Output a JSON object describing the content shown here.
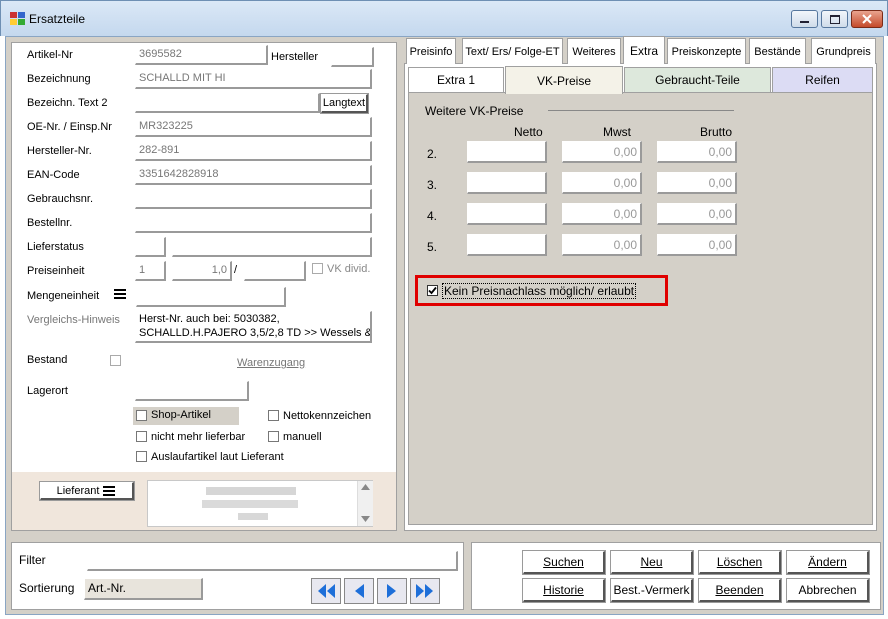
{
  "window": {
    "title": "Ersatzteile"
  },
  "form": {
    "artikel_nr": {
      "label": "Artikel-Nr",
      "value": "3695582"
    },
    "hersteller": {
      "label": "Hersteller"
    },
    "bezeichnung": {
      "label": "Bezeichnung",
      "value": "SCHALLD MIT HI"
    },
    "bezeichn_text2": {
      "label": "Bezeichn. Text 2",
      "value": ""
    },
    "langtext_button": "Langtext",
    "oe_nr": {
      "label": "OE-Nr. / Einsp.Nr",
      "value": "MR323225"
    },
    "hersteller_nr": {
      "label": "Hersteller-Nr.",
      "value": "282-891"
    },
    "ean_code": {
      "label": "EAN-Code",
      "value": "3351642828918"
    },
    "gebrauchsnr": {
      "label": "Gebrauchsnr."
    },
    "bestellnr": {
      "label": "Bestellnr."
    },
    "lieferstatus": {
      "label": "Lieferstatus"
    },
    "preiseinheit": {
      "label": "Preiseinheit",
      "value1": "1",
      "value2": "1,0",
      "slash": "/"
    },
    "vk_divid": "VK divid.",
    "mengeneinheit": {
      "label": "Mengeneinheit"
    },
    "vergleichs_hinweis": {
      "label": "Vergleichs-Hinweis",
      "line1": "Herst-Nr. auch bei: 5030382,",
      "line2": "SCHALLD.H.PAJERO 3,5/2,8 TD >> Wessels &"
    },
    "bestand": {
      "label": "Bestand"
    },
    "warenzugang": "Warenzugang",
    "lagerort": {
      "label": "Lagerort"
    },
    "checkboxes": {
      "shop_artikel": "Shop-Artikel",
      "nettokennzeichen": "Nettokennzeichen",
      "nicht_mehr_lieferbar": "nicht mehr lieferbar",
      "manuell": "manuell",
      "auslaufartikel": "Auslaufartikel laut Lieferant"
    },
    "lieferant_button": "Lieferant"
  },
  "tabs": [
    "Preisinfo",
    "Text/ Ers/ Folge-ET",
    "Weiteres",
    "Extra",
    "Preiskonzepte",
    "Bestände",
    "Grundpreis"
  ],
  "subtabs": [
    "Extra 1",
    "VK-Preise",
    "Gebraucht-Teile",
    "Reifen"
  ],
  "vk_preise": {
    "group_title": "Weitere VK-Preise",
    "col_netto": "Netto",
    "col_mwst": "Mwst",
    "col_brutto": "Brutto",
    "rows": [
      {
        "n": "2.",
        "netto": "",
        "mwst": "0,00",
        "brutto": "0,00"
      },
      {
        "n": "3.",
        "netto": "",
        "mwst": "0,00",
        "brutto": "0,00"
      },
      {
        "n": "4.",
        "netto": "",
        "mwst": "0,00",
        "brutto": "0,00"
      },
      {
        "n": "5.",
        "netto": "",
        "mwst": "0,00",
        "brutto": "0,00"
      }
    ],
    "kein_preisnachlass": "Kein Preisnachlass möglich/ erlaubt"
  },
  "bottom": {
    "filter_label": "Filter",
    "sortierung_label": "Sortierung",
    "sortierung_value": "Art.-Nr.",
    "buttons": [
      "Suchen",
      "Neu",
      "Löschen",
      "Ändern",
      "Historie",
      "Best.-Vermerk",
      "Beenden",
      "Abbrechen"
    ]
  },
  "colors": {
    "highlight_border": "#e00000",
    "active_subtab_bg": "#f4f2e8",
    "gebraucht_bg": "#dde8dc",
    "reifen_bg": "#dcdcf4"
  }
}
